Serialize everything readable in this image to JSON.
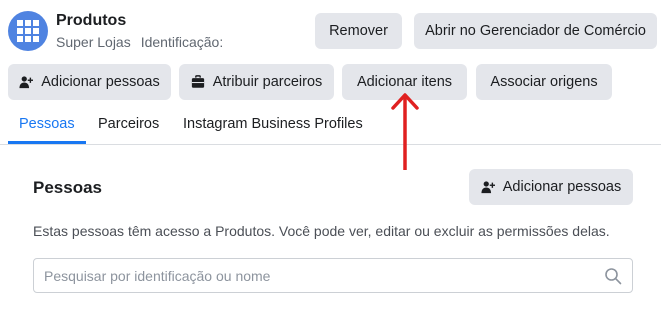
{
  "asset": {
    "name": "Produtos",
    "business": "Super Lojas",
    "id_label": "Identificação:",
    "icon": "catalog-grid-icon"
  },
  "header_actions": {
    "remove_label": "Remover",
    "open_commerce_manager_label": "Abrir no Gerenciador de Comércio"
  },
  "toolbar": {
    "add_people_label": "Adicionar pessoas",
    "assign_partners_label": "Atribuir parceiros",
    "add_items_label": "Adicionar itens",
    "associate_sources_label": "Associar origens"
  },
  "tabs": [
    {
      "label": "Pessoas",
      "active": true
    },
    {
      "label": "Parceiros",
      "active": false
    },
    {
      "label": "Instagram Business Profiles",
      "active": false
    }
  ],
  "people_section": {
    "title": "Pessoas",
    "add_people_label": "Adicionar pessoas",
    "description": "Estas pessoas têm acesso a Produtos. Você pode ver, editar ou excluir as permissões delas.",
    "search_placeholder": "Pesquisar por identificação ou nome"
  },
  "annotation": {
    "arrow_color": "#e02020",
    "arrow_icon": "red-up-arrow-annotation"
  },
  "colors": {
    "accent": "#1877f2",
    "button_bg": "#e4e6eb",
    "icon_bg": "#4f83e1"
  }
}
